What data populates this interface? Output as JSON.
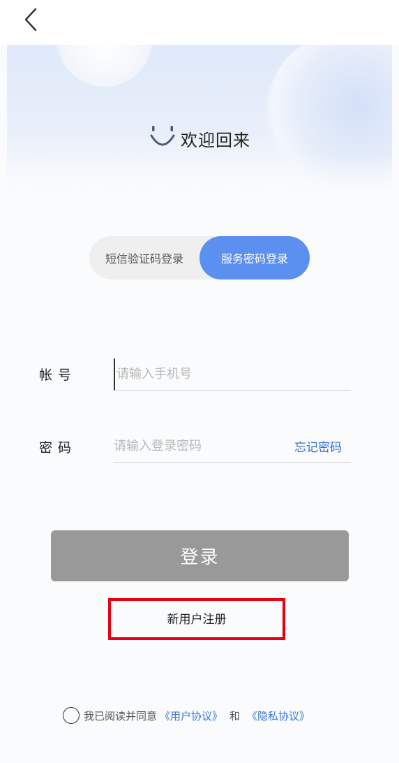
{
  "header": {
    "back_icon": "chevron-left-icon"
  },
  "hero": {
    "title": "欢迎回来",
    "smile_icon": "smile-icon"
  },
  "login_modes": {
    "sms_label": "短信验证码登录",
    "password_label": "服务密码登录",
    "selected": "password",
    "active_color": "#5b8ff0"
  },
  "form": {
    "account_label": "帐号",
    "account_placeholder": "请输入手机号",
    "password_label": "密码",
    "password_placeholder": "请输入登录密码",
    "forgot_label": "忘记密码"
  },
  "login_button": {
    "label": "登录",
    "color": "#999999"
  },
  "register": {
    "label": "新用户注册",
    "highlight_color": "#e60012"
  },
  "agreement": {
    "prefix": "我已阅读并同意",
    "user_agreement": "《用户协议》",
    "conjunction": "和",
    "privacy_agreement": "《隐私协议》",
    "checked": false
  }
}
